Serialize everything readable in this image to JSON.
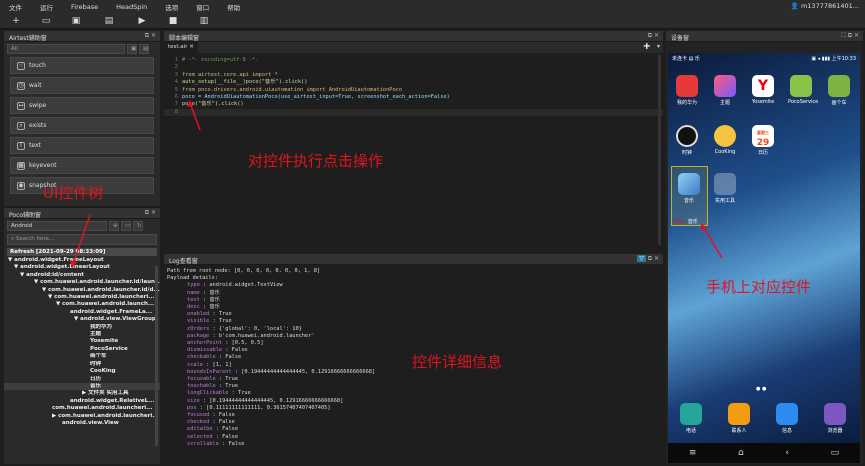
{
  "menu": {
    "items": [
      "文件",
      "运行",
      "Firebase",
      "HeadSpin",
      "选项",
      "窗口",
      "帮助"
    ],
    "user": "m13777861401..."
  },
  "airtest": {
    "title": "Airtest辅助窗",
    "filter": "All",
    "buttons": [
      "touch",
      "wait",
      "swipe",
      "exists",
      "text",
      "keyevent",
      "snapshot"
    ]
  },
  "poco": {
    "title": "Poco辅助窗",
    "mode": "Android",
    "search_placeholder": "Search here...",
    "refresh": "Refresh [2021-09-29  08:33:09]",
    "tree": [
      "▼ android.widget.FrameLayout",
      "▼ android.widget.LinearLayout",
      "▼ android:id/content",
      "▼ com.huawei.android.launcher.id/laun...",
      "▼ com.huawei.android.launcher.id/d...",
      "▼ com.huawei.android.launcheri...",
      "▼ com.huawei.android.launch...",
      "android.widget.FrameLa...",
      "▼ android.view.ViewGroup",
      "我的华为",
      "主题",
      "Yosemite",
      "PocoService",
      "画个车",
      "时钟",
      "CooKing",
      "日历",
      "音乐",
      "▶ 文件夹 实用工具",
      "android.widget.RelativeL...",
      "com.huawei.android.launcheri...",
      "▶ com.huawei.android.launcheri...",
      "android.view.View"
    ]
  },
  "editor": {
    "title": "脚本编辑窗",
    "tab": "test.air",
    "lines": [
      "# -*- encoding=utf-8 -*-",
      "",
      "from airtest.core.api import *",
      "auto_setup(__file__)poco(\"音乐\").click()",
      "from poco.drivers.android.uiautomation import AndroidUiautomationPoco",
      "poco = AndroidUiautomationPoco(use_airtest_input=True, screenshot_each_action=False)",
      "poco(\"音乐\").click()",
      ""
    ],
    "line_numbers": [
      "1",
      "2",
      "3",
      "4",
      "5",
      "6",
      "7",
      "8"
    ]
  },
  "log": {
    "title": "Log查看窗",
    "path": "Path from root node: [0, 0, 0, 0, 0, 0, 0, 1, 8]",
    "payload": "Payload details:",
    "rows": [
      [
        "type",
        ":  android.widget.TextView"
      ],
      [
        "name",
        ":  音乐"
      ],
      [
        "text",
        ":  音乐"
      ],
      [
        "desc",
        ":  音乐"
      ],
      [
        "enabled",
        ":  True"
      ],
      [
        "visible",
        ":  True"
      ],
      [
        "zOrders",
        ":  {'global': 0, 'local': 10}"
      ],
      [
        "package",
        ":  b'com.huawei.android.launcher'"
      ],
      [
        "anchorPoint",
        ":  [0.5, 0.5]"
      ],
      [
        "dismissable",
        ":  False"
      ],
      [
        "checkable",
        ":  False"
      ],
      [
        "scale",
        ":  [1, 1]"
      ],
      [
        "boundsInParent",
        ":  [0.19444444444444445, 0.12916666666666668]"
      ],
      [
        "focusable",
        ":  True"
      ],
      [
        "touchable",
        ":  True"
      ],
      [
        "longClickable",
        ":  True"
      ],
      [
        "size",
        ":  [0.19444444444444445, 0.12916666666666668]"
      ],
      [
        "pos",
        ":  [0.11111111111111, 0.36157407407407405]"
      ],
      [
        "focused",
        ":  False"
      ],
      [
        "checked",
        ":  False"
      ],
      [
        "editalbe",
        ":  False"
      ],
      [
        "selected",
        ":  False"
      ],
      [
        "scrollable",
        ":  False"
      ]
    ]
  },
  "device": {
    "title": "设备窗",
    "status_left": "未连卡 ▤ 乐",
    "status_right": "▣ ◂ ▮▮▮ 上午10:33",
    "apps": [
      "我的华为",
      "主题",
      "Yosemite",
      "PocoService",
      "画个车",
      "时钟",
      "CooKing",
      "日历",
      "音乐",
      "实用工具"
    ],
    "calendar_day": "29",
    "calendar_label": "星期三",
    "label_other": "Other",
    "dock": [
      "电话",
      "联系人",
      "信息",
      "浏览器"
    ]
  },
  "annotations": {
    "click": "对控件执行点击操作",
    "tree": "UI控件树",
    "detail": "控件详细信息",
    "phone": "手机上对应控件"
  },
  "colors": {
    "accent": "#e0141e",
    "bg": "#1e1e1e"
  }
}
